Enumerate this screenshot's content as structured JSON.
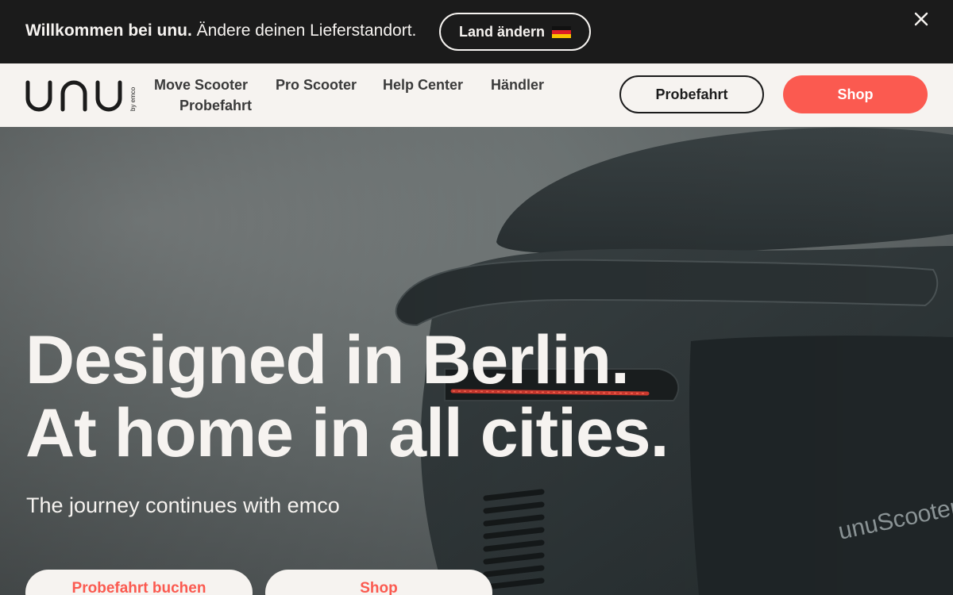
{
  "banner": {
    "welcome_bold": "Willkommen bei unu.",
    "welcome_text": "Ändere deinen Lieferstandort.",
    "change_country_label": "Land ändern",
    "flag_icon": "germany-flag-icon",
    "close_icon": "close-icon"
  },
  "nav": {
    "logo_text": "unu",
    "logo_sub": "by emco",
    "links": [
      "Move Scooter",
      "Pro Scooter",
      "Help Center",
      "Händler",
      "Probefahrt"
    ],
    "probefahrt_label": "Probefahrt",
    "shop_label": "Shop"
  },
  "hero": {
    "title_line1": "Designed in Berlin.",
    "title_line2": "At home in all cities.",
    "subtitle": "The journey continues with emco",
    "btn_testride": "Probefahrt buchen",
    "btn_shop": "Shop",
    "scooter_brand": "unuScooter"
  },
  "colors": {
    "accent": "#fb5a50",
    "dark": "#1b1b1b",
    "light": "#f6f3f0"
  }
}
